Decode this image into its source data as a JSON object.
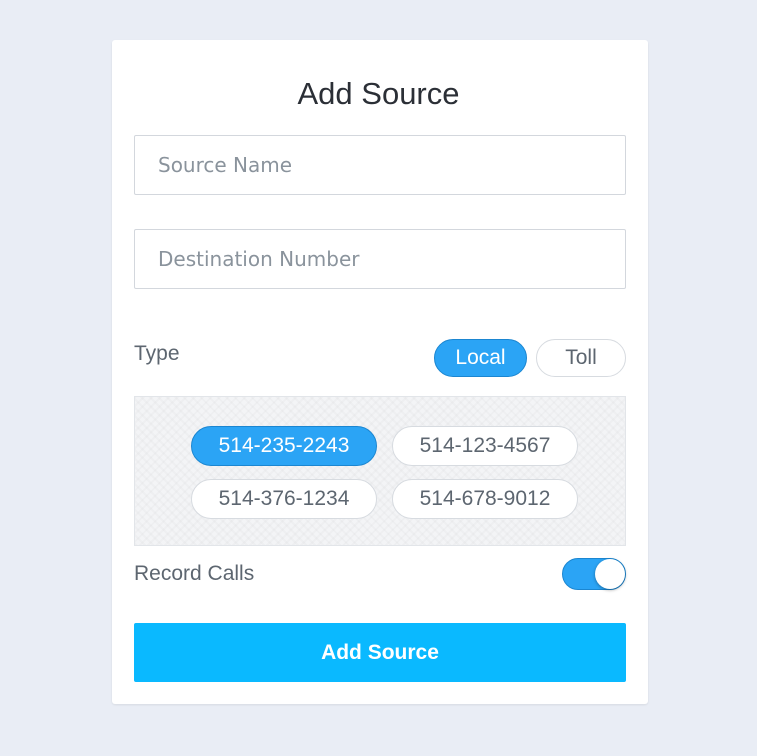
{
  "form": {
    "title": "Add Source",
    "source_name": {
      "value": "",
      "placeholder": "Source Name"
    },
    "destination_number": {
      "value": "",
      "placeholder": "Destination Number"
    },
    "type": {
      "label": "Type",
      "options": [
        "Local",
        "Toll"
      ],
      "selected": "Local"
    },
    "numbers": {
      "items": [
        "514-235-2243",
        "514-123-4567",
        "514-376-1234",
        "514-678-9012"
      ],
      "selected": "514-235-2243"
    },
    "record_calls": {
      "label": "Record Calls",
      "enabled": true
    },
    "submit_label": "Add Source"
  },
  "colors": {
    "background": "#e9edf5",
    "accent": "#2ba4f5",
    "submit": "#0ab9ff",
    "text": "#5d6670"
  }
}
